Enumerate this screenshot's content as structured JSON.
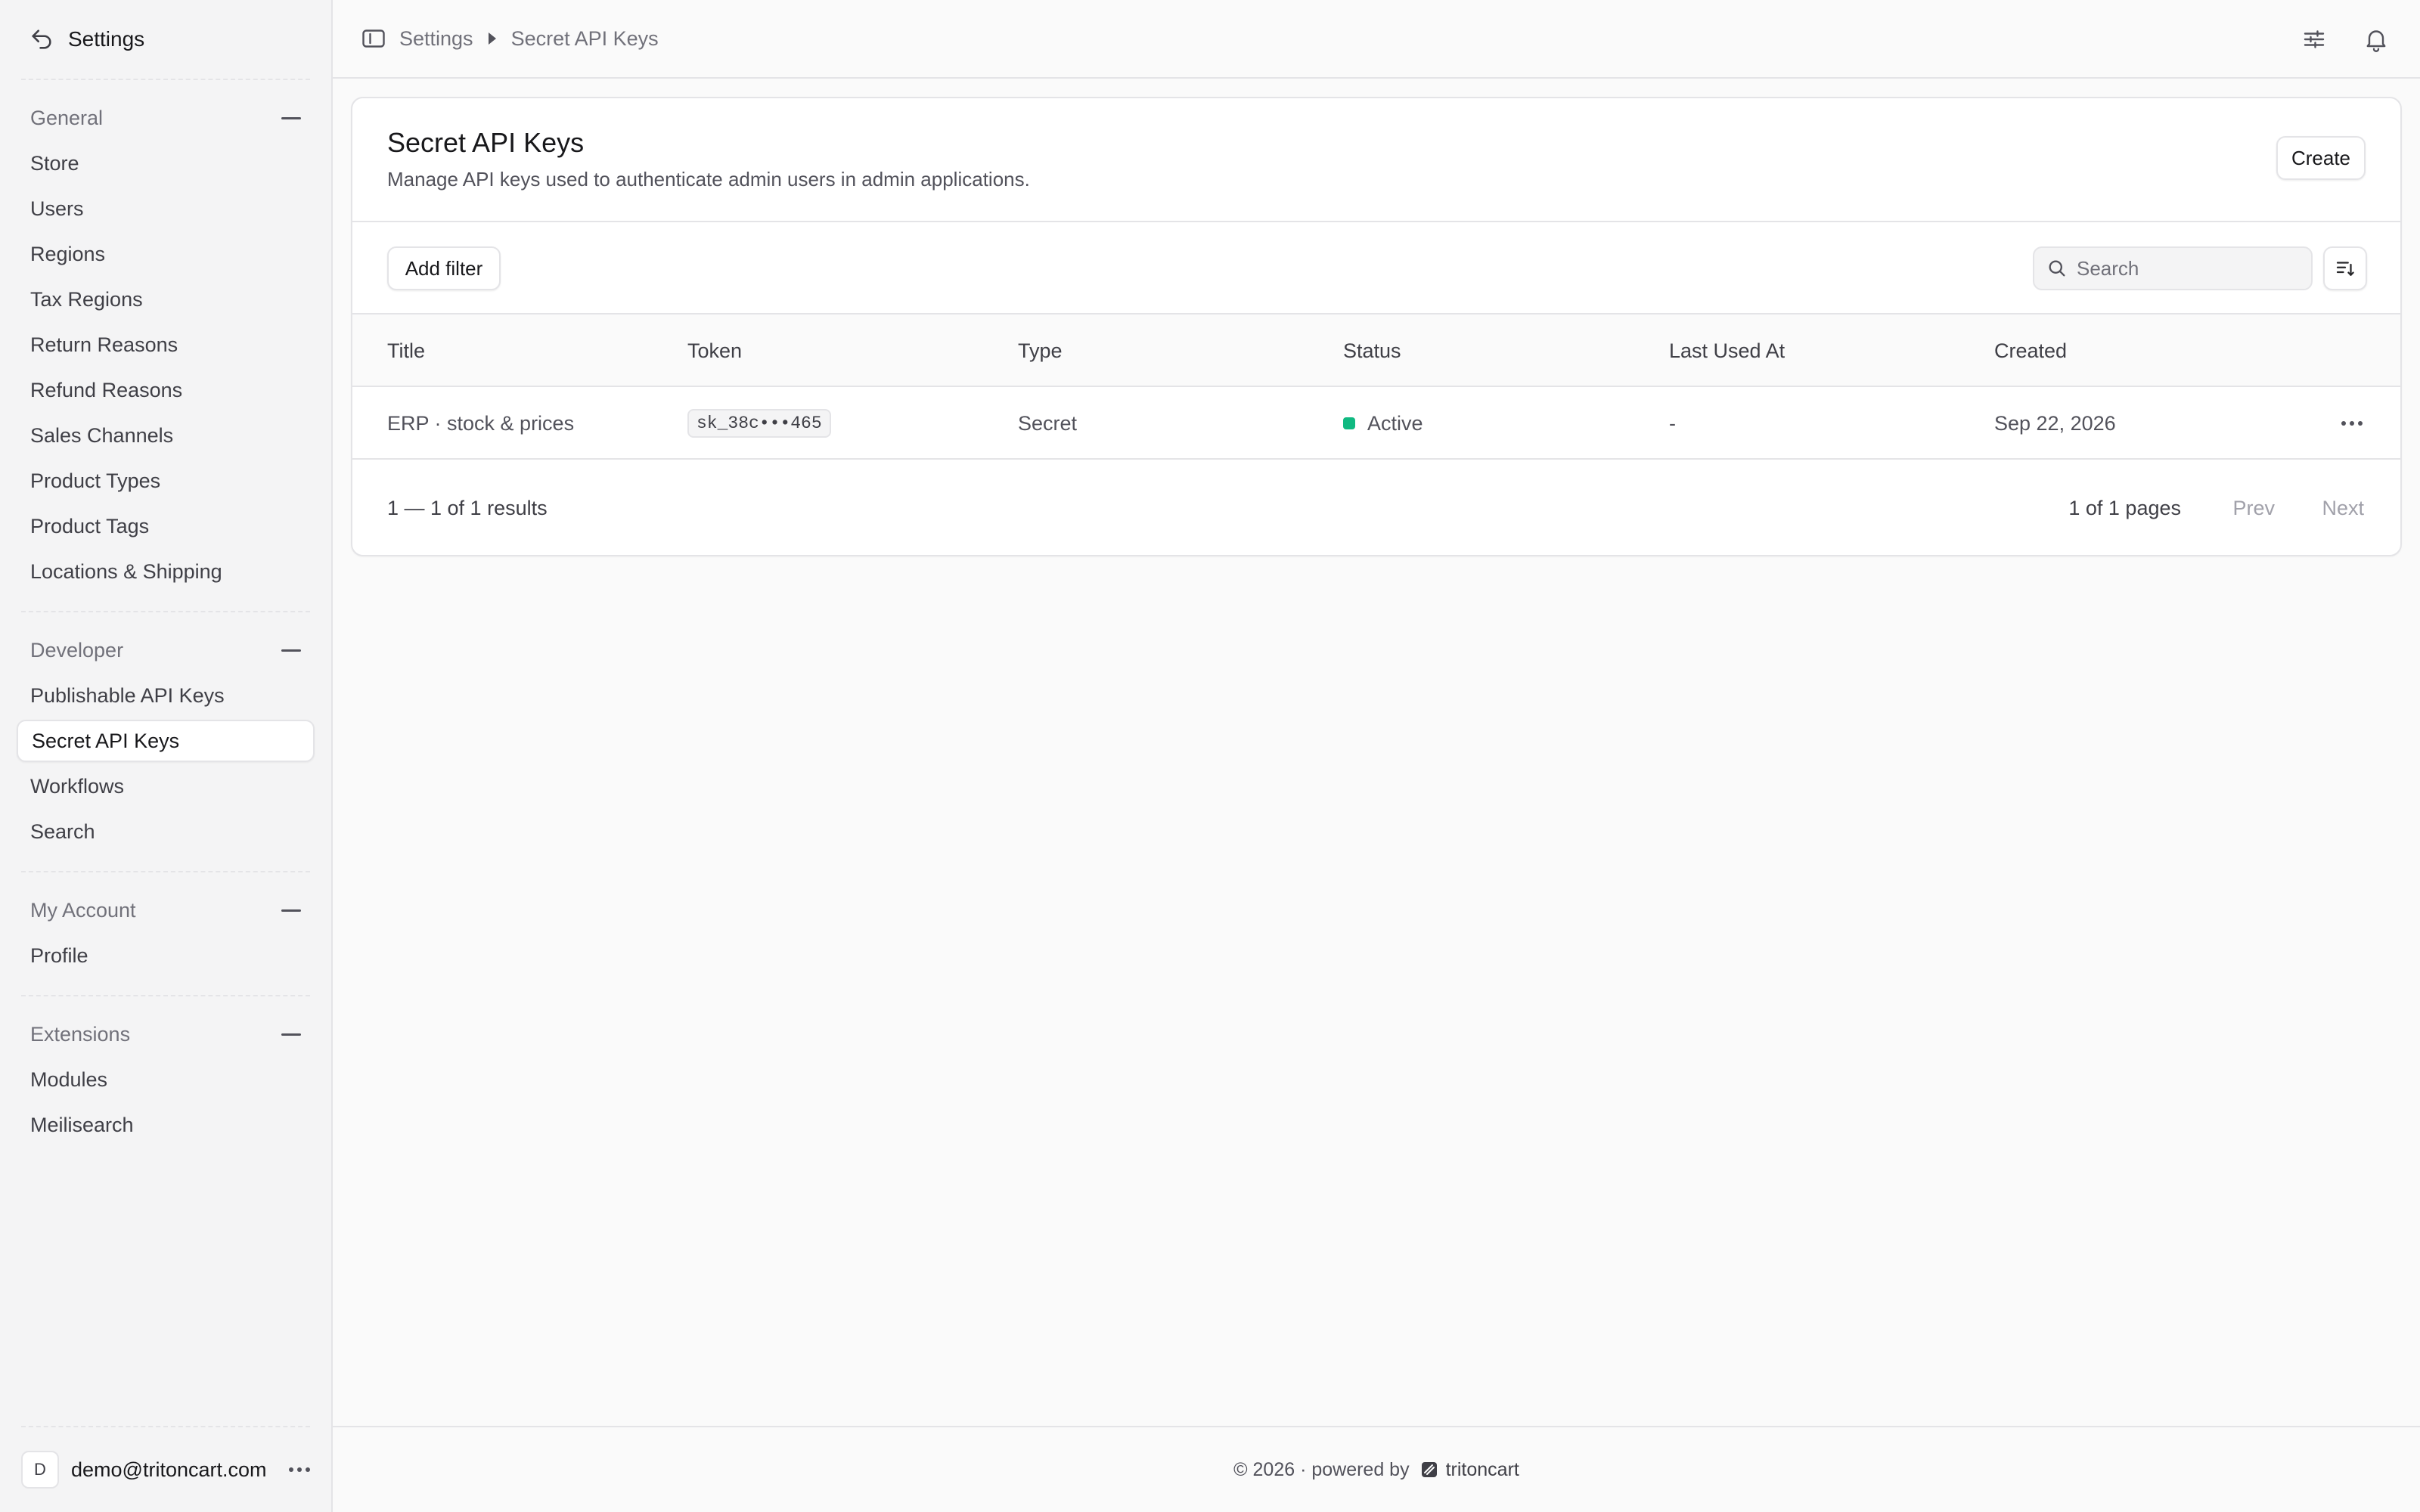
{
  "sidebar": {
    "title": "Settings",
    "groups": [
      {
        "title": "General",
        "items": [
          "Store",
          "Users",
          "Regions",
          "Tax Regions",
          "Return Reasons",
          "Refund Reasons",
          "Sales Channels",
          "Product Types",
          "Product Tags",
          "Locations & Shipping"
        ]
      },
      {
        "title": "Developer",
        "items": [
          "Publishable API Keys",
          "Secret API Keys",
          "Workflows",
          "Search"
        ]
      },
      {
        "title": "My Account",
        "items": [
          "Profile"
        ]
      },
      {
        "title": "Extensions",
        "items": [
          "Modules",
          "Meilisearch"
        ]
      }
    ],
    "active_item": "Secret API Keys",
    "user": {
      "initial": "D",
      "email": "demo@tritoncart.com"
    }
  },
  "topbar": {
    "breadcrumb": [
      "Settings",
      "Secret API Keys"
    ]
  },
  "page": {
    "title": "Secret API Keys",
    "subtitle": "Manage API keys used to authenticate admin users in admin applications.",
    "create_label": "Create",
    "add_filter_label": "Add filter",
    "search_placeholder": "Search"
  },
  "table": {
    "columns": [
      "Title",
      "Token",
      "Type",
      "Status",
      "Last Used At",
      "Created"
    ],
    "rows": [
      {
        "title": "ERP · stock & prices",
        "token": "sk_38c•••465",
        "type": "Secret",
        "status": "Active",
        "last_used": "-",
        "created": "Sep 22, 2026"
      }
    ]
  },
  "pagination": {
    "results": "1 — 1 of 1 results",
    "pages": "1 of 1 pages",
    "prev_label": "Prev",
    "next_label": "Next"
  },
  "footer": {
    "text": "© 2026 · powered by",
    "brand": "tritoncart"
  },
  "colors": {
    "status_active": "#10b981",
    "background": "#fafafa",
    "border": "#e4e4e7"
  }
}
